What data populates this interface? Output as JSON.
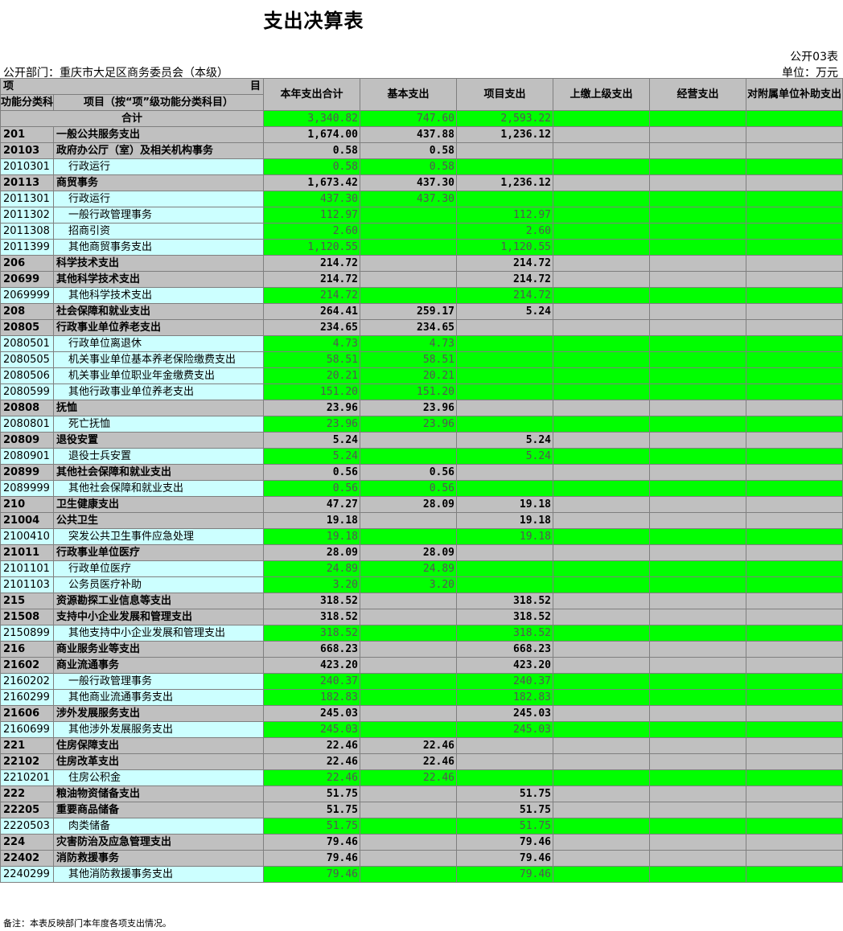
{
  "title": "支出决算表",
  "form_code": "公开03表",
  "department": "公开部门：重庆市大足区商务委员会（本级）",
  "unit": "单位：万元",
  "header": {
    "item_left": "项",
    "item_right": "目",
    "code_col": "功能分类科目编码",
    "name_col": "项目（按“项”级功能分类科目）",
    "cols": [
      "本年支出合计",
      "基本支出",
      "项目支出",
      "上缴上级支出",
      "经营支出",
      "对附属单位补助支出"
    ]
  },
  "total": {
    "label": "合计",
    "values": [
      "3,340.82",
      "747.60",
      "2,593.22",
      "",
      "",
      ""
    ]
  },
  "rows": [
    {
      "level": 1,
      "code": "201",
      "name": "一般公共服务支出",
      "values": [
        "1,674.00",
        "437.88",
        "1,236.12",
        "",
        "",
        ""
      ]
    },
    {
      "level": 2,
      "code": "20103",
      "name": "政府办公厅（室）及相关机构事务",
      "values": [
        "0.58",
        "0.58",
        "",
        "",
        "",
        ""
      ]
    },
    {
      "level": 3,
      "code": "2010301",
      "name": "行政运行",
      "values": [
        "0.58",
        "0.58",
        "",
        "",
        "",
        ""
      ]
    },
    {
      "level": 2,
      "code": "20113",
      "name": "商贸事务",
      "values": [
        "1,673.42",
        "437.30",
        "1,236.12",
        "",
        "",
        ""
      ]
    },
    {
      "level": 3,
      "code": "2011301",
      "name": "行政运行",
      "values": [
        "437.30",
        "437.30",
        "",
        "",
        "",
        ""
      ]
    },
    {
      "level": 3,
      "code": "2011302",
      "name": "一般行政管理事务",
      "values": [
        "112.97",
        "",
        "112.97",
        "",
        "",
        ""
      ]
    },
    {
      "level": 3,
      "code": "2011308",
      "name": "招商引资",
      "values": [
        "2.60",
        "",
        "2.60",
        "",
        "",
        ""
      ]
    },
    {
      "level": 3,
      "code": "2011399",
      "name": "其他商贸事务支出",
      "values": [
        "1,120.55",
        "",
        "1,120.55",
        "",
        "",
        ""
      ]
    },
    {
      "level": 1,
      "code": "206",
      "name": "科学技术支出",
      "values": [
        "214.72",
        "",
        "214.72",
        "",
        "",
        ""
      ]
    },
    {
      "level": 2,
      "code": "20699",
      "name": "其他科学技术支出",
      "values": [
        "214.72",
        "",
        "214.72",
        "",
        "",
        ""
      ]
    },
    {
      "level": 3,
      "code": "2069999",
      "name": "其他科学技术支出",
      "values": [
        "214.72",
        "",
        "214.72",
        "",
        "",
        ""
      ]
    },
    {
      "level": 1,
      "code": "208",
      "name": "社会保障和就业支出",
      "values": [
        "264.41",
        "259.17",
        "5.24",
        "",
        "",
        ""
      ]
    },
    {
      "level": 2,
      "code": "20805",
      "name": "行政事业单位养老支出",
      "values": [
        "234.65",
        "234.65",
        "",
        "",
        "",
        ""
      ]
    },
    {
      "level": 3,
      "code": "2080501",
      "name": "行政单位离退休",
      "values": [
        "4.73",
        "4.73",
        "",
        "",
        "",
        ""
      ]
    },
    {
      "level": 3,
      "code": "2080505",
      "name": "机关事业单位基本养老保险缴费支出",
      "values": [
        "58.51",
        "58.51",
        "",
        "",
        "",
        ""
      ]
    },
    {
      "level": 3,
      "code": "2080506",
      "name": "机关事业单位职业年金缴费支出",
      "values": [
        "20.21",
        "20.21",
        "",
        "",
        "",
        ""
      ]
    },
    {
      "level": 3,
      "code": "2080599",
      "name": "其他行政事业单位养老支出",
      "values": [
        "151.20",
        "151.20",
        "",
        "",
        "",
        ""
      ]
    },
    {
      "level": 2,
      "code": "20808",
      "name": "抚恤",
      "values": [
        "23.96",
        "23.96",
        "",
        "",
        "",
        ""
      ]
    },
    {
      "level": 3,
      "code": "2080801",
      "name": "死亡抚恤",
      "values": [
        "23.96",
        "23.96",
        "",
        "",
        "",
        ""
      ]
    },
    {
      "level": 2,
      "code": "20809",
      "name": "退役安置",
      "values": [
        "5.24",
        "",
        "5.24",
        "",
        "",
        ""
      ]
    },
    {
      "level": 3,
      "code": "2080901",
      "name": "退役士兵安置",
      "values": [
        "5.24",
        "",
        "5.24",
        "",
        "",
        ""
      ]
    },
    {
      "level": 2,
      "code": "20899",
      "name": "其他社会保障和就业支出",
      "values": [
        "0.56",
        "0.56",
        "",
        "",
        "",
        ""
      ]
    },
    {
      "level": 3,
      "code": "2089999",
      "name": "其他社会保障和就业支出",
      "values": [
        "0.56",
        "0.56",
        "",
        "",
        "",
        ""
      ]
    },
    {
      "level": 1,
      "code": "210",
      "name": "卫生健康支出",
      "values": [
        "47.27",
        "28.09",
        "19.18",
        "",
        "",
        ""
      ]
    },
    {
      "level": 2,
      "code": "21004",
      "name": "公共卫生",
      "values": [
        "19.18",
        "",
        "19.18",
        "",
        "",
        ""
      ]
    },
    {
      "level": 3,
      "code": "2100410",
      "name": "突发公共卫生事件应急处理",
      "values": [
        "19.18",
        "",
        "19.18",
        "",
        "",
        ""
      ]
    },
    {
      "level": 2,
      "code": "21011",
      "name": "行政事业单位医疗",
      "values": [
        "28.09",
        "28.09",
        "",
        "",
        "",
        ""
      ]
    },
    {
      "level": 3,
      "code": "2101101",
      "name": "行政单位医疗",
      "values": [
        "24.89",
        "24.89",
        "",
        "",
        "",
        ""
      ]
    },
    {
      "level": 3,
      "code": "2101103",
      "name": "公务员医疗补助",
      "values": [
        "3.20",
        "3.20",
        "",
        "",
        "",
        ""
      ]
    },
    {
      "level": 1,
      "code": "215",
      "name": "资源勘探工业信息等支出",
      "values": [
        "318.52",
        "",
        "318.52",
        "",
        "",
        ""
      ]
    },
    {
      "level": 2,
      "code": "21508",
      "name": "支持中小企业发展和管理支出",
      "values": [
        "318.52",
        "",
        "318.52",
        "",
        "",
        ""
      ]
    },
    {
      "level": 3,
      "code": "2150899",
      "name": "其他支持中小企业发展和管理支出",
      "values": [
        "318.52",
        "",
        "318.52",
        "",
        "",
        ""
      ]
    },
    {
      "level": 1,
      "code": "216",
      "name": "商业服务业等支出",
      "values": [
        "668.23",
        "",
        "668.23",
        "",
        "",
        ""
      ]
    },
    {
      "level": 2,
      "code": "21602",
      "name": "商业流通事务",
      "values": [
        "423.20",
        "",
        "423.20",
        "",
        "",
        ""
      ]
    },
    {
      "level": 3,
      "code": "2160202",
      "name": "一般行政管理事务",
      "values": [
        "240.37",
        "",
        "240.37",
        "",
        "",
        ""
      ]
    },
    {
      "level": 3,
      "code": "2160299",
      "name": "其他商业流通事务支出",
      "values": [
        "182.83",
        "",
        "182.83",
        "",
        "",
        ""
      ]
    },
    {
      "level": 2,
      "code": "21606",
      "name": "涉外发展服务支出",
      "values": [
        "245.03",
        "",
        "245.03",
        "",
        "",
        ""
      ]
    },
    {
      "level": 3,
      "code": "2160699",
      "name": "其他涉外发展服务支出",
      "values": [
        "245.03",
        "",
        "245.03",
        "",
        "",
        ""
      ]
    },
    {
      "level": 1,
      "code": "221",
      "name": "住房保障支出",
      "values": [
        "22.46",
        "22.46",
        "",
        "",
        "",
        ""
      ]
    },
    {
      "level": 2,
      "code": "22102",
      "name": "住房改革支出",
      "values": [
        "22.46",
        "22.46",
        "",
        "",
        "",
        ""
      ]
    },
    {
      "level": 3,
      "code": "2210201",
      "name": "住房公积金",
      "values": [
        "22.46",
        "22.46",
        "",
        "",
        "",
        ""
      ]
    },
    {
      "level": 1,
      "code": "222",
      "name": "粮油物资储备支出",
      "values": [
        "51.75",
        "",
        "51.75",
        "",
        "",
        ""
      ]
    },
    {
      "level": 2,
      "code": "22205",
      "name": "重要商品储备",
      "values": [
        "51.75",
        "",
        "51.75",
        "",
        "",
        ""
      ]
    },
    {
      "level": 3,
      "code": "2220503",
      "name": "肉类储备",
      "values": [
        "51.75",
        "",
        "51.75",
        "",
        "",
        ""
      ]
    },
    {
      "level": 1,
      "code": "224",
      "name": "灾害防治及应急管理支出",
      "values": [
        "79.46",
        "",
        "79.46",
        "",
        "",
        ""
      ]
    },
    {
      "level": 2,
      "code": "22402",
      "name": "消防救援事务",
      "values": [
        "79.46",
        "",
        "79.46",
        "",
        "",
        ""
      ]
    },
    {
      "level": 3,
      "code": "2240299",
      "name": "其他消防救援事务支出",
      "values": [
        "79.46",
        "",
        "79.46",
        "",
        "",
        ""
      ]
    }
  ],
  "note": "备注：本表反映部门本年度各项支出情况。"
}
